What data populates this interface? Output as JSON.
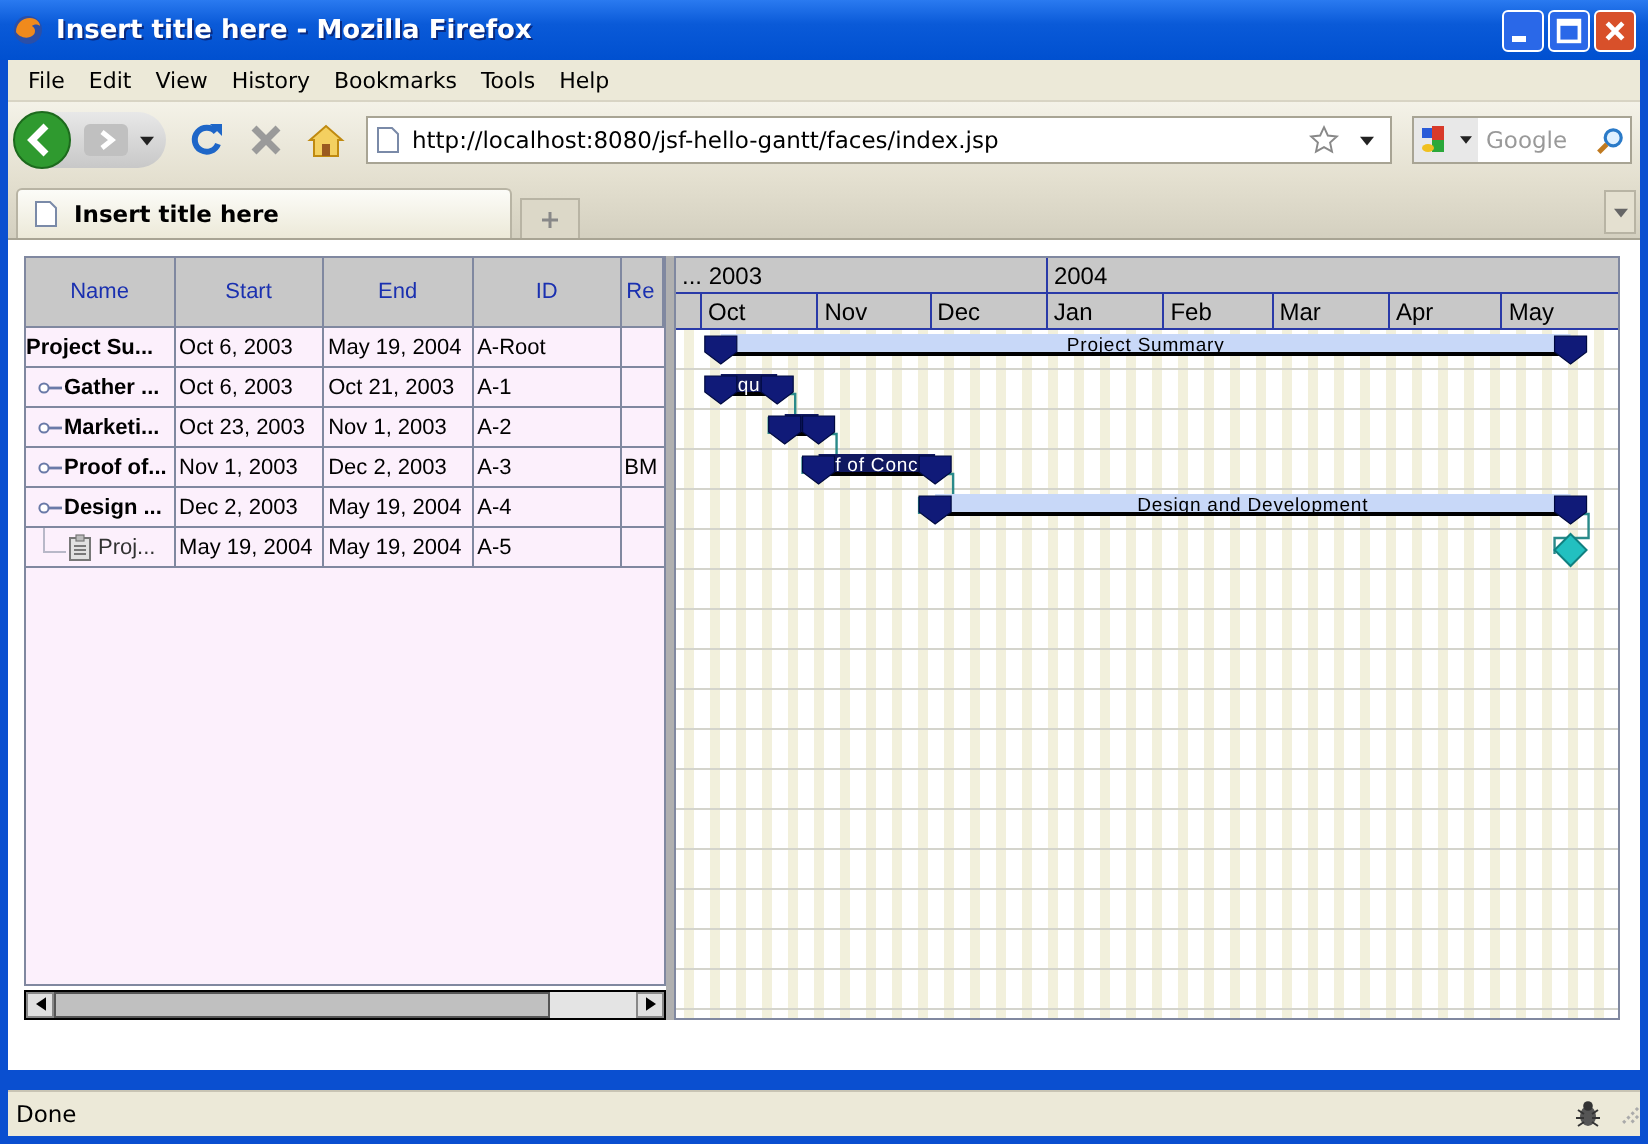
{
  "window": {
    "title": "Insert title here - Mozilla Firefox"
  },
  "menu": [
    "File",
    "Edit",
    "View",
    "History",
    "Bookmarks",
    "Tools",
    "Help"
  ],
  "address": {
    "value": "http://localhost:8080/jsf-hello-gantt/faces/index.jsp"
  },
  "search": {
    "placeholder": "Google"
  },
  "tabs": [
    {
      "label": "Insert title here",
      "selected": true
    }
  ],
  "table": {
    "columns": [
      "Name",
      "Start",
      "End",
      "ID",
      "Re"
    ],
    "rows": [
      {
        "name": "Project Su...",
        "start": "Oct 6, 2003",
        "end": "May 19, 2004",
        "id": "A-Root",
        "kind": "group",
        "bar": {
          "kind": "summary",
          "label": "Project Summary"
        },
        "children": [
          {
            "name": "Gather ...",
            "start": "Oct 6, 2003",
            "end": "Oct 21, 2003",
            "id": "A-1",
            "kind": "group",
            "expanded": false,
            "bar": {
              "kind": "task",
              "label": "qu"
            }
          },
          {
            "name": "Marketi...",
            "start": "Oct 23, 2003",
            "end": "Nov 1, 2003",
            "id": "A-2",
            "kind": "group",
            "expanded": false,
            "bar": {
              "kind": "task",
              "linked": true
            }
          },
          {
            "name": "Proof of...",
            "start": "Nov 1, 2003",
            "end": "Dec 2, 2003",
            "id": "A-3",
            "column_5": "BM",
            "kind": "group",
            "expanded": false,
            "bar": {
              "kind": "task",
              "label": "f of Conc",
              "linked": true
            }
          },
          {
            "name": "Design ...",
            "start": "Dec 2, 2003",
            "end": "May 19, 2004",
            "id": "A-4",
            "kind": "group",
            "expanded": false,
            "bar": {
              "kind": "summary",
              "label": "Design and Development",
              "linked": true
            }
          },
          {
            "name": "Proj...",
            "start": "May 19, 2004",
            "end": "May 19, 2004",
            "id": "A-5",
            "kind": "leaf",
            "bar": {
              "kind": "milestone",
              "linked": true
            }
          }
        ]
      }
    ]
  },
  "gantt": {
    "years": [
      "... 2003",
      "2004"
    ],
    "months": [
      "Oct",
      "Nov",
      "Dec",
      "Jan",
      "Feb",
      "Mar",
      "Apr",
      "May"
    ]
  },
  "status_bar": {
    "text": "Done"
  }
}
